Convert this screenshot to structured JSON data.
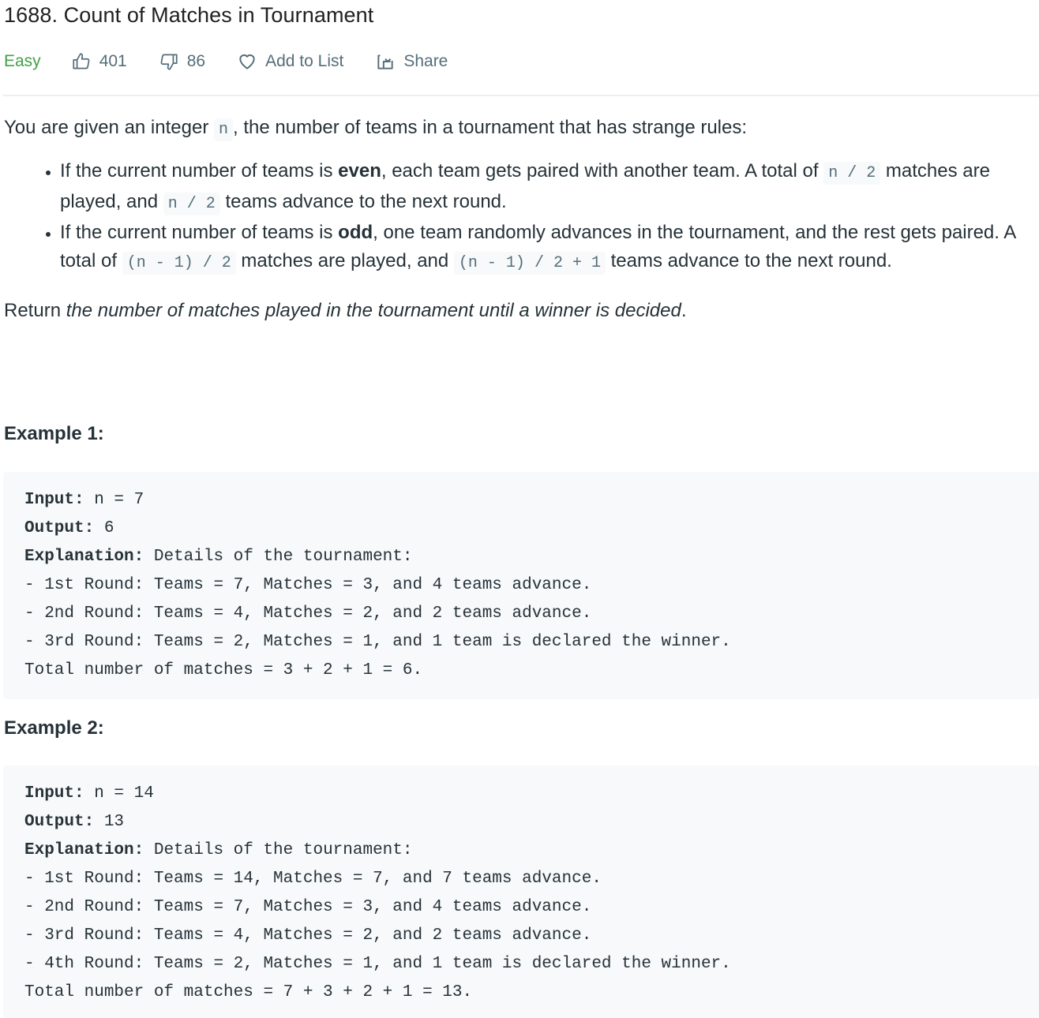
{
  "problem": {
    "title": "1688. Count of Matches in Tournament",
    "difficulty": "Easy",
    "likes": "401",
    "dislikes": "86",
    "add_to_list_label": "Add to List",
    "share_label": "Share"
  },
  "description": {
    "intro_before": "You are given an integer ",
    "intro_code": "n",
    "intro_after": ", the number of teams in a tournament that has strange rules:",
    "rules": [
      {
        "before_bold": "If the current number of teams is ",
        "bold": "even",
        "after_bold": ", each team gets paired with another team. A total of ",
        "code1": "n / 2",
        "middle": " matches are played, and ",
        "code2": "n / 2",
        "end": " teams advance to the next round."
      },
      {
        "before_bold": "If the current number of teams is ",
        "bold": "odd",
        "after_bold": ", one team randomly advances in the tournament, and the rest gets paired. A total of ",
        "code1": "(n - 1) / 2",
        "middle": " matches are played, and ",
        "code2": "(n - 1) / 2 + 1",
        "end": " teams advance to the next round."
      }
    ],
    "return_prefix": "Return ",
    "return_italic": "the number of matches played in the tournament until a winner is decided",
    "return_suffix": "."
  },
  "examples": [
    {
      "heading": "Example 1:",
      "input_label": "Input:",
      "input_value": " n = 7",
      "output_label": "Output:",
      "output_value": " 6",
      "explanation_label": "Explanation:",
      "explanation_value": " Details of the tournament:",
      "details": [
        "- 1st Round: Teams = 7, Matches = 3, and 4 teams advance.",
        "- 2nd Round: Teams = 4, Matches = 2, and 2 teams advance.",
        "- 3rd Round: Teams = 2, Matches = 1, and 1 team is declared the winner.",
        "Total number of matches = 3 + 2 + 1 = 6."
      ]
    },
    {
      "heading": "Example 2:",
      "input_label": "Input:",
      "input_value": " n = 14",
      "output_label": "Output:",
      "output_value": " 13",
      "explanation_label": "Explanation:",
      "explanation_value": " Details of the tournament:",
      "details": [
        "- 1st Round: Teams = 14, Matches = 7, and 7 teams advance.",
        "- 2nd Round: Teams = 7, Matches = 3, and 4 teams advance.",
        "- 3rd Round: Teams = 4, Matches = 2, and 2 teams advance.",
        "- 4th Round: Teams = 2, Matches = 1, and 1 team is declared the winner.",
        "Total number of matches = 7 + 3 + 2 + 1 = 13."
      ]
    }
  ],
  "colors": {
    "easy": "#43a047",
    "meta_text": "#546e7a",
    "code_bg": "#f7f9fa",
    "text": "#263238"
  }
}
